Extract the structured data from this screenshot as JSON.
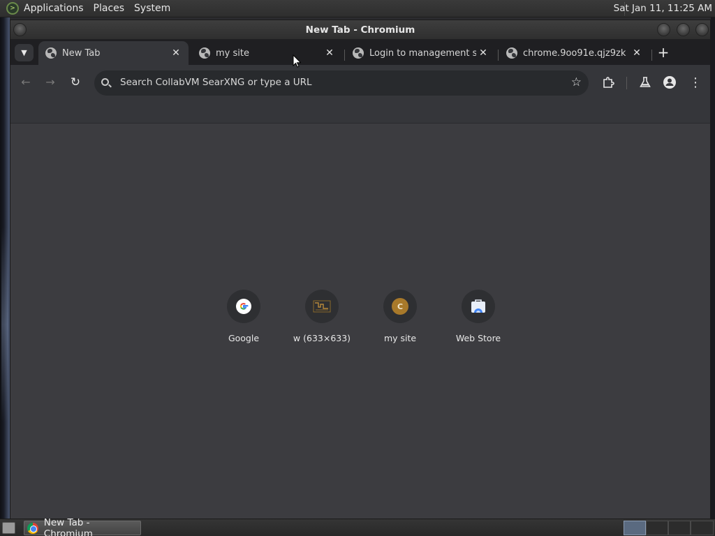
{
  "top_panel": {
    "menus": [
      "Applications",
      "Places",
      "System"
    ],
    "clock": "Sat Jan 11, 11:25 AM"
  },
  "window": {
    "title": "New Tab - Chromium"
  },
  "tabs": [
    {
      "label": "New Tab",
      "active": true
    },
    {
      "label": "my site",
      "active": false
    },
    {
      "label": "Login to management sys",
      "active": false
    },
    {
      "label": "chrome.9oo91e.qjz9zk",
      "active": false
    }
  ],
  "omnibox": {
    "placeholder": "Search CollabVM SearXNG or type a URL"
  },
  "shortcuts": [
    {
      "title": "Google",
      "icon": "google-icon"
    },
    {
      "title": "w (633×633)",
      "icon": "w-site-icon"
    },
    {
      "title": "my site",
      "icon": "c-letter-icon",
      "letter": "C"
    },
    {
      "title": "Web Store",
      "icon": "web-store-icon"
    }
  ],
  "taskbar": {
    "task_label": "New Tab - Chromium"
  },
  "colors": {
    "tab_active": "#35363a",
    "content_bg": "#3c3c40",
    "omnibox_bg": "#282a2d"
  }
}
